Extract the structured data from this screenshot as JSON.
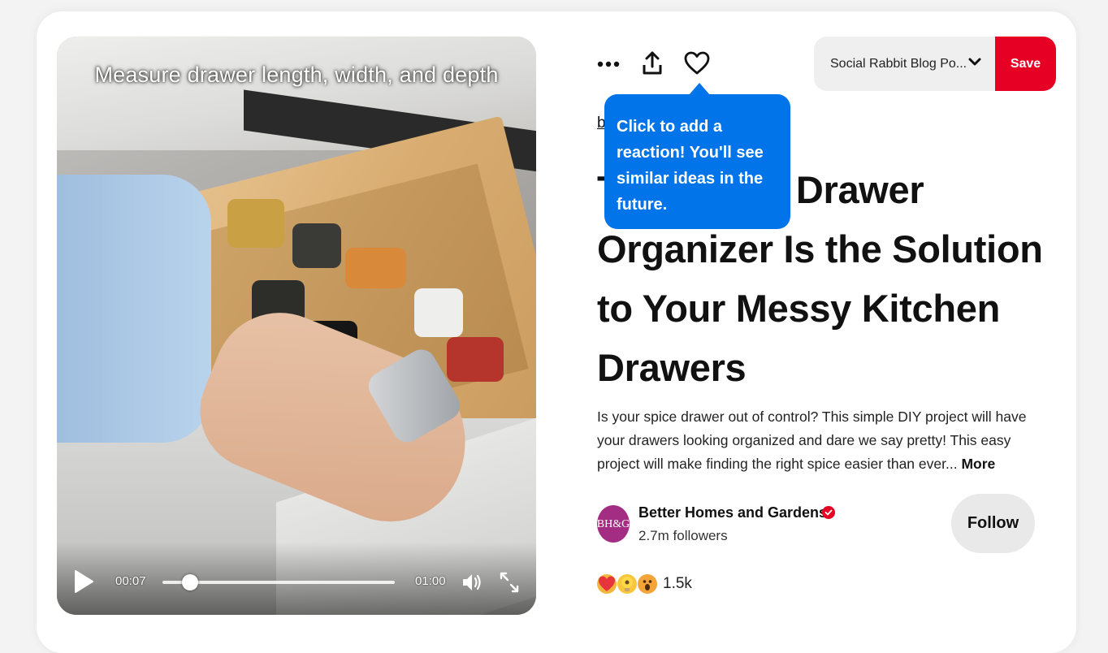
{
  "video": {
    "caption": "Measure drawer length, width, and depth",
    "current_time": "00:07",
    "duration": "01:00",
    "progress_fraction": 0.12
  },
  "toolbar": {
    "more_icon": "more-dots-icon",
    "share_icon": "share-icon",
    "heart_icon": "heart-icon"
  },
  "board_select": {
    "label": "Social Rabbit Blog Po...",
    "chevron": "chevron-down-icon"
  },
  "save_label": "Save",
  "link_fragment": "b",
  "title": "This Spice Drawer Organizer Is the Solution to Your Messy Kitchen Drawers",
  "tooltip": {
    "text": "Click to add a reaction! You'll see similar ideas in the future."
  },
  "description": {
    "text": "Is your spice drawer out of control? This simple DIY project will have your drawers looking organized and dare we say pretty! This easy project will make finding the right spice easier than ever...",
    "more_label": "More"
  },
  "author": {
    "avatar_text": "BH&G",
    "name": "Better Homes and Gardens",
    "followers": "2.7m followers",
    "verified": true
  },
  "follow_label": "Follow",
  "reactions": {
    "icons": [
      "heart-eyes-icon",
      "lightbulb-icon",
      "wow-face-icon"
    ],
    "count": "1.5k"
  },
  "colors": {
    "save_red": "#e60023",
    "tooltip_blue": "#0074e8",
    "avatar_purple": "#a42d84"
  }
}
